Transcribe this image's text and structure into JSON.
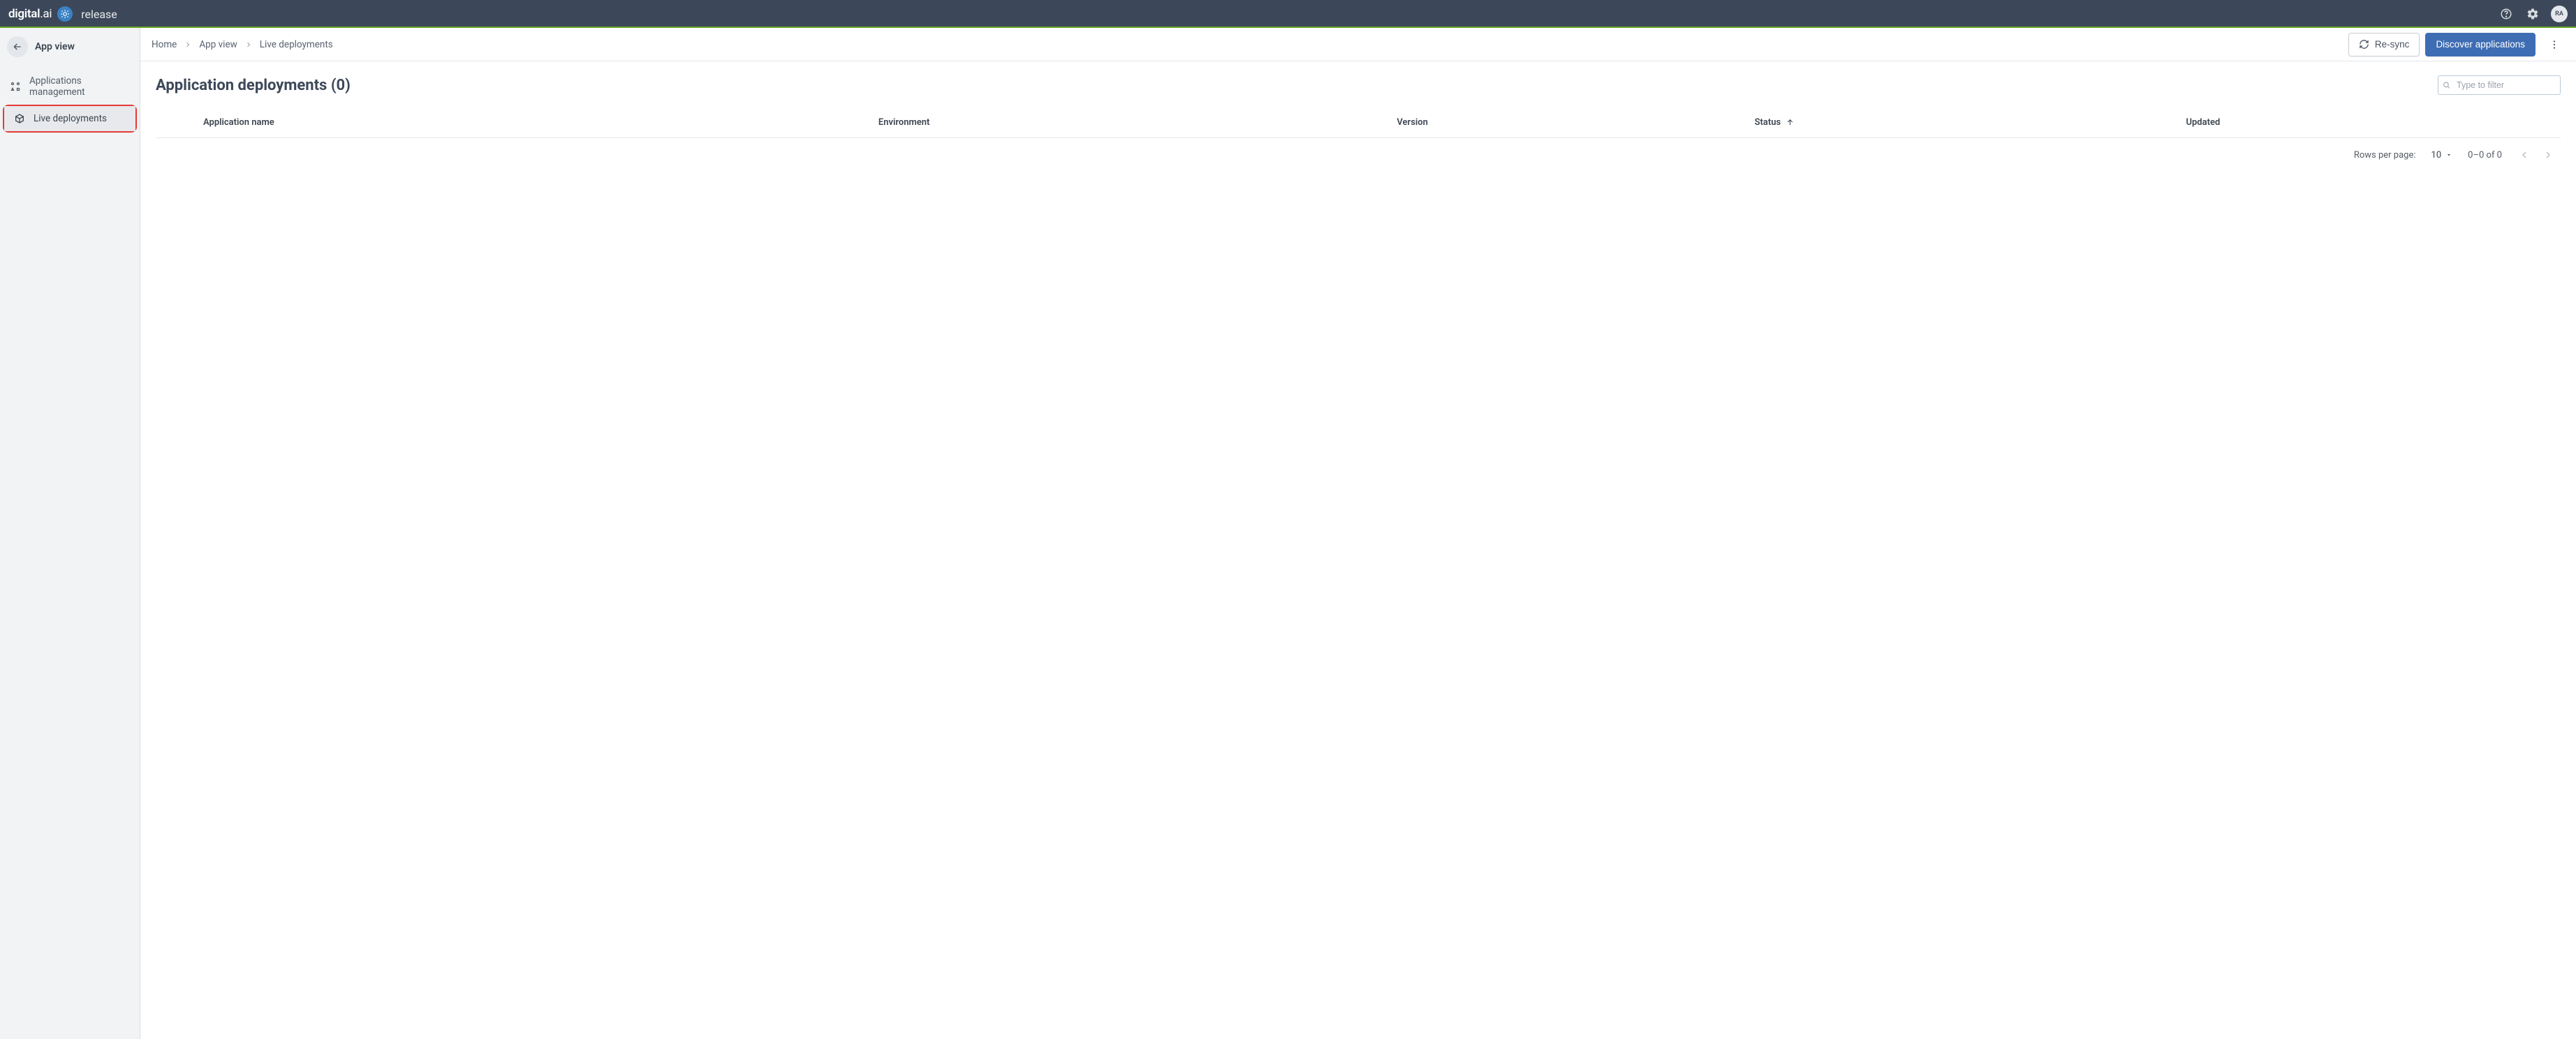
{
  "brand": {
    "name_a": "digital",
    "name_b": ".ai",
    "product": "release"
  },
  "topbar": {
    "avatar_initials": "RA"
  },
  "sidebar": {
    "title": "App view",
    "items": [
      {
        "label": "Applications management"
      },
      {
        "label": "Live deployments"
      }
    ]
  },
  "breadcrumbs": [
    {
      "label": "Home"
    },
    {
      "label": "App view"
    },
    {
      "label": "Live deployments"
    }
  ],
  "actions": {
    "resync_label": "Re-sync",
    "discover_label": "Discover applications"
  },
  "page": {
    "title": "Application deployments (0)",
    "filter_placeholder": "Type to filter"
  },
  "table": {
    "columns": [
      {
        "label": "Application name"
      },
      {
        "label": "Environment"
      },
      {
        "label": "Version"
      },
      {
        "label": "Status",
        "sorted": "asc"
      },
      {
        "label": "Updated"
      }
    ],
    "rows": []
  },
  "pagination": {
    "rows_per_page_label": "Rows per page:",
    "rows_per_page_value": "10",
    "range_text": "0–0 of 0"
  }
}
